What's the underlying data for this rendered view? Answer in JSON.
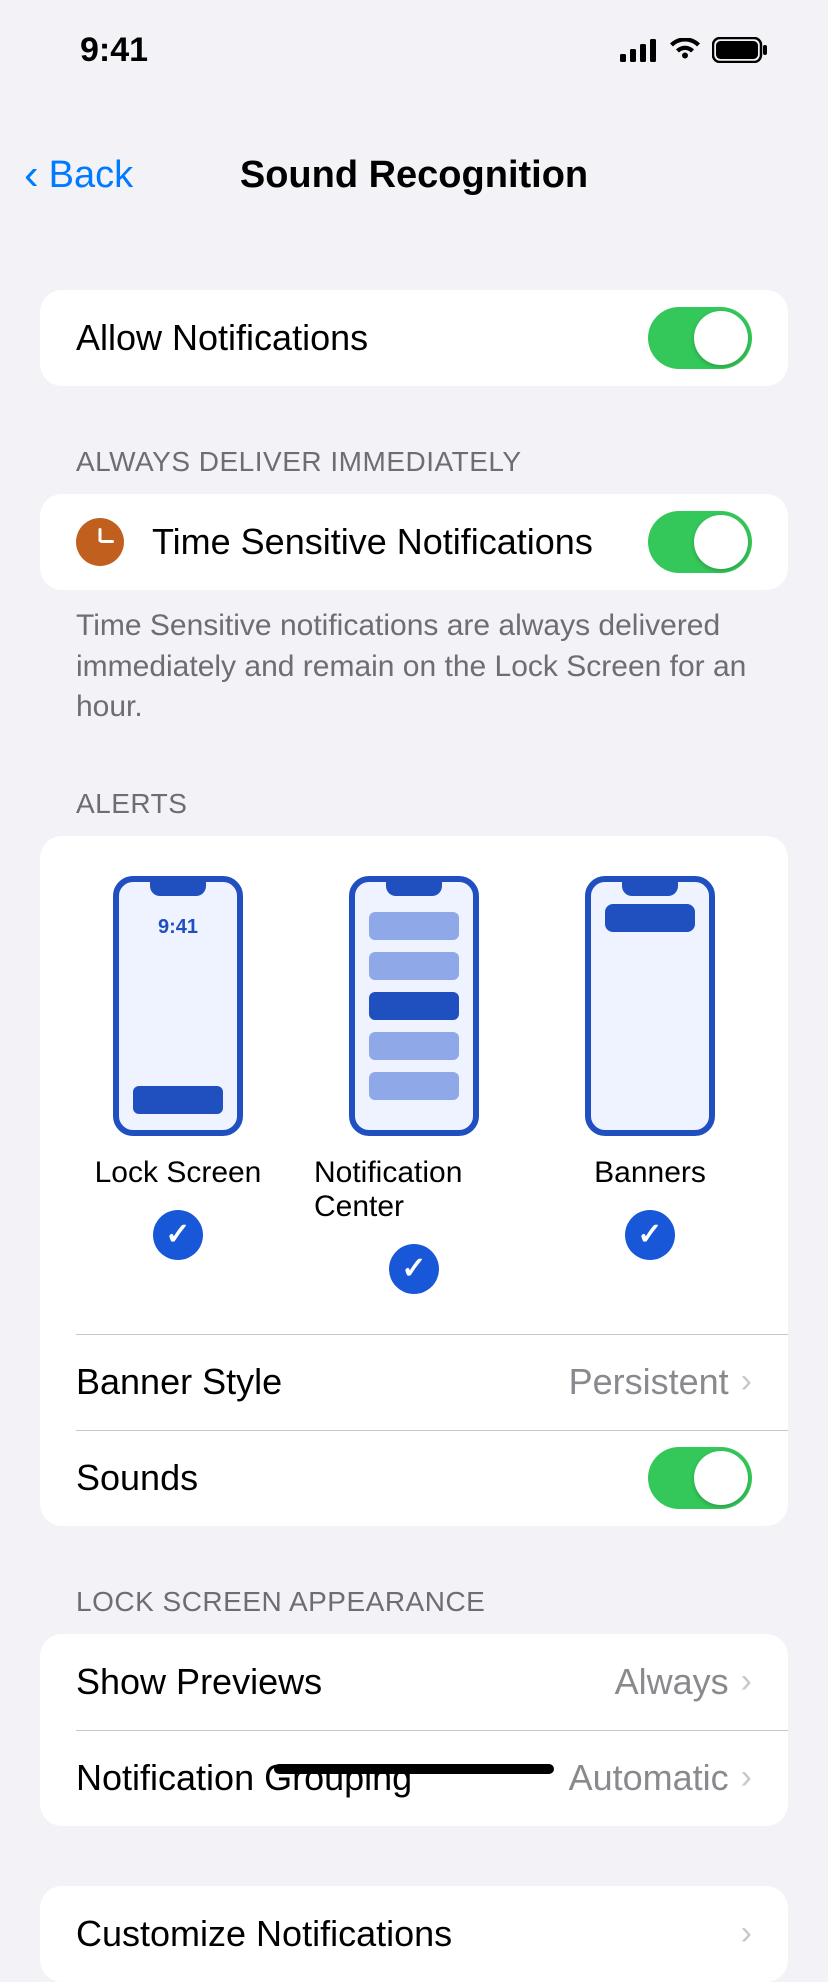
{
  "status": {
    "time": "9:41"
  },
  "nav": {
    "back": "Back",
    "title": "Sound Recognition"
  },
  "allow": {
    "label": "Allow Notifications"
  },
  "deliver": {
    "header": "Always Deliver Immediately",
    "timeSensitive": "Time Sensitive Notifications",
    "footer": "Time Sensitive notifications are always delivered immediately and remain on the Lock Screen for an hour."
  },
  "alerts": {
    "header": "Alerts",
    "lockScreen": "Lock Screen",
    "lockScreenTime": "9:41",
    "notificationCenter": "Notification Center",
    "banners": "Banners",
    "bannerStyle": {
      "label": "Banner Style",
      "value": "Persistent"
    },
    "sounds": "Sounds"
  },
  "lockAppearance": {
    "header": "Lock Screen Appearance",
    "showPreviews": {
      "label": "Show Previews",
      "value": "Always"
    },
    "grouping": {
      "label": "Notification Grouping",
      "value": "Automatic"
    }
  },
  "customize": "Customize Notifications"
}
